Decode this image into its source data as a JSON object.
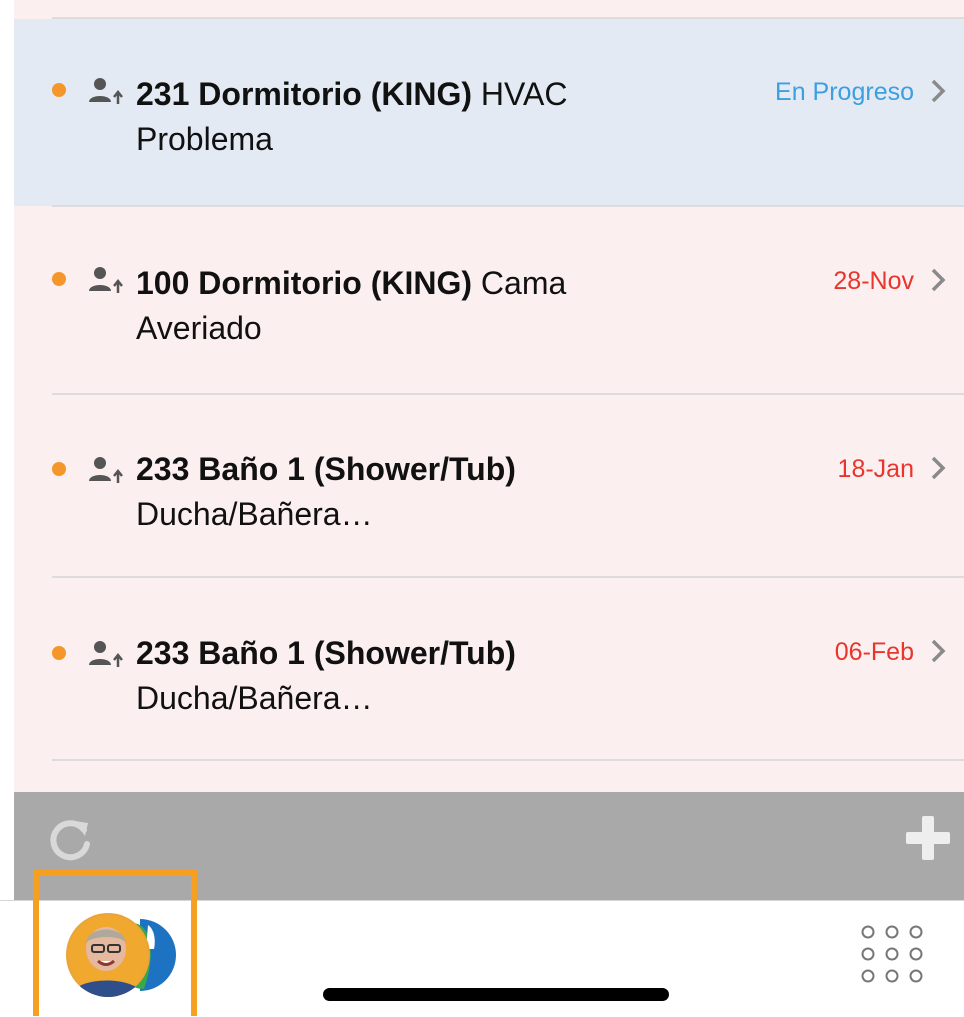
{
  "tasks": [
    {
      "title_bold": "231 Dormitorio (KING)",
      "title_rest": " HVAC Problema",
      "status": "En Progreso",
      "status_color": "#3b9fe0",
      "selected": true
    },
    {
      "title_bold": "100 Dormitorio (KING)",
      "title_rest": " Cama Averiado",
      "status": "28-Nov",
      "status_color": "#e8352d",
      "selected": false
    },
    {
      "title_bold": "233 Baño 1 (Shower/Tub)",
      "title_rest": " Ducha/Bañera…",
      "status": "18-Jan",
      "status_color": "#e8352d",
      "selected": false
    },
    {
      "title_bold": "233 Baño 1 (Shower/Tub)",
      "title_rest": " Ducha/Bañera…",
      "status": "06-Feb",
      "status_color": "#e8352d",
      "selected": false
    }
  ],
  "colors": {
    "list_background": "#fcefef",
    "selected_background": "#e3eaf4",
    "bullet": "#f5962a",
    "toolbar": "#a9a9a9",
    "profile_highlight": "#f5a020"
  },
  "icons": {
    "toolbar_left": "refresh-icon",
    "toolbar_right": "plus-icon",
    "row_person": "person-assigned-icon",
    "row_chevron": "chevron-right-icon",
    "menu": "grid-menu-icon"
  }
}
